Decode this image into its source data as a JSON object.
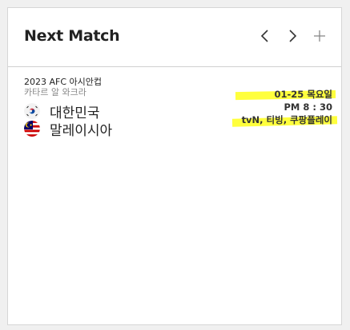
{
  "header": {
    "title": "Next Match"
  },
  "match": {
    "league": "2023 AFC 아시안컵",
    "venue": "카타르 알 와크라",
    "home_team": "대한민국",
    "away_team": "말레이시아",
    "date": "01-25 목요일",
    "time": "PM 8 : 30",
    "broadcast": "tvN, 티빙, 쿠팡플레이"
  },
  "colors": {
    "highlight": "#ffff3d",
    "title": "#222222",
    "venue": "#888888"
  },
  "icons": {
    "prev": "chevron-left-icon",
    "next": "chevron-right-icon",
    "add": "plus-icon"
  }
}
